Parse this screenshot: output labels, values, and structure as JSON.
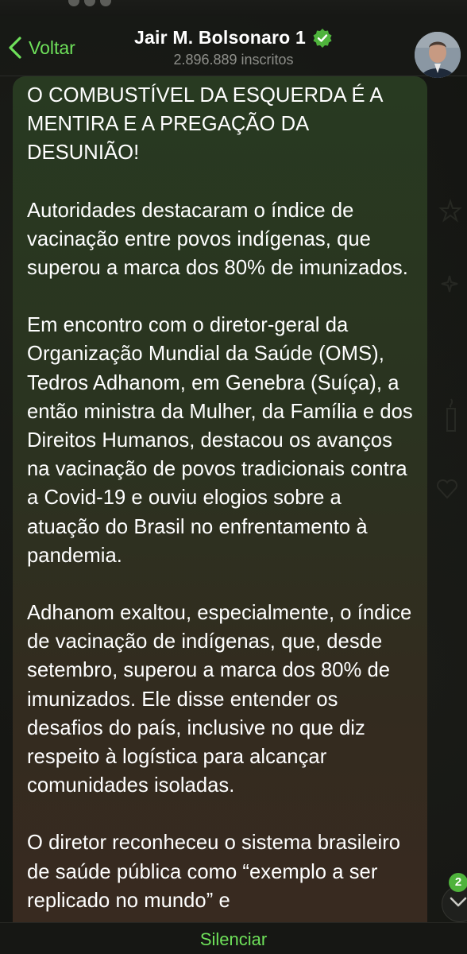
{
  "header": {
    "back_label": "Voltar",
    "title": "Jair M. Bolsonaro 1",
    "subscribers": "2.896.889 inscritos",
    "verified": true
  },
  "message": {
    "paragraphs": [
      "O COMBUSTÍVEL DA ESQUERDA É A MENTIRA E A PREGAÇÃO DA DESUNIÃO!",
      "Autoridades destacaram o índice de vacinação entre povos indígenas, que superou a marca dos 80% de imunizados.",
      "Em encontro com o diretor-geral da Organização Mundial da Saúde (OMS), Tedros Adhanom, em Genebra (Suíça), a então ministra da Mulher, da Família e dos Direitos Humanos, destacou os avanços na vacinação de povos tradicionais contra a Covid-19 e ouviu elogios sobre a atuação do Brasil no enfrentamento à pandemia.",
      "Adhanom exaltou, especialmente, o índice de vacinação de indígenas, que, desde setembro, superou a marca dos 80% de imunizados. Ele disse entender os desafios do país, inclusive no que diz respeito à logística para alcançar comunidades isoladas.",
      "O diretor reconheceu o sistema brasileiro de saúde pública como “exemplo a ser replicado no mundo” e"
    ]
  },
  "scroll": {
    "unread_count": "2"
  },
  "bottom_bar": {
    "label": "Silenciar"
  },
  "colors": {
    "accent": "#6ee05a",
    "verified_badge": "#4fb33c",
    "background": "#121311"
  },
  "icons": [
    "chevron-left-icon",
    "verified-badge-icon",
    "chevron-down-icon"
  ]
}
